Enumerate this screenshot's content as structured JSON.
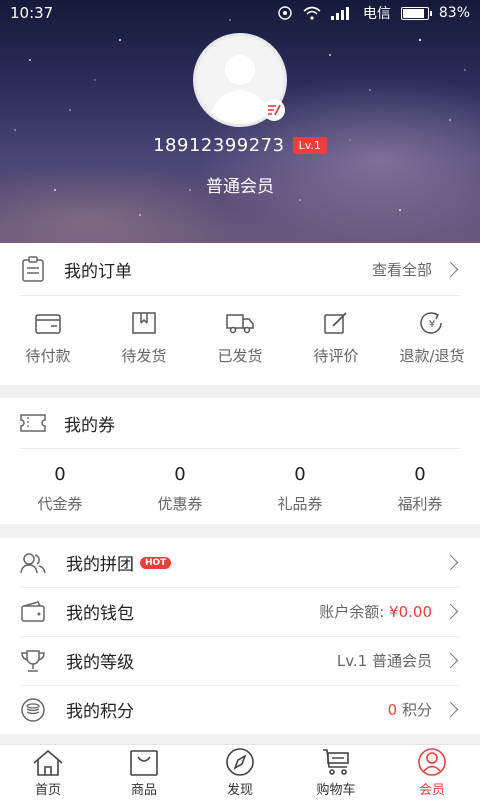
{
  "status_bar": {
    "time": "10:37",
    "carrier": "电信",
    "battery_text": "83%",
    "battery_level": 0.83
  },
  "profile": {
    "phone": "18912399273",
    "level_badge": "Lv.1",
    "member_type": "普通会员"
  },
  "orders": {
    "title": "我的订单",
    "view_all": "查看全部",
    "items": [
      {
        "label": "待付款",
        "icon": "wallet-icon"
      },
      {
        "label": "待发货",
        "icon": "box-icon"
      },
      {
        "label": "已发货",
        "icon": "truck-icon"
      },
      {
        "label": "待评价",
        "icon": "edit-icon"
      },
      {
        "label": "退款/退货",
        "icon": "refund-icon"
      }
    ]
  },
  "coupons": {
    "title": "我的券",
    "items": [
      {
        "count": "0",
        "label": "代金券"
      },
      {
        "count": "0",
        "label": "优惠券"
      },
      {
        "count": "0",
        "label": "礼品券"
      },
      {
        "count": "0",
        "label": "福利券"
      }
    ]
  },
  "menu": {
    "group_buy": {
      "title": "我的拼团",
      "badge": "HOT"
    },
    "wallet": {
      "title": "我的钱包",
      "balance_label": "账户余额:",
      "balance_value": "¥0.00"
    },
    "level": {
      "title": "我的等级",
      "value": "Lv.1 普通会员"
    },
    "points": {
      "title": "我的积分",
      "value": "0",
      "unit": "积分"
    }
  },
  "tabbar": [
    {
      "label": "首页",
      "icon": "home-icon"
    },
    {
      "label": "商品",
      "icon": "shopping-bag-icon"
    },
    {
      "label": "发现",
      "icon": "compass-icon"
    },
    {
      "label": "购物车",
      "icon": "cart-icon"
    },
    {
      "label": "会员",
      "icon": "user-icon",
      "active": true
    }
  ],
  "colors": {
    "accent": "#ef3d3d",
    "text": "#222222",
    "muted": "#666666"
  }
}
